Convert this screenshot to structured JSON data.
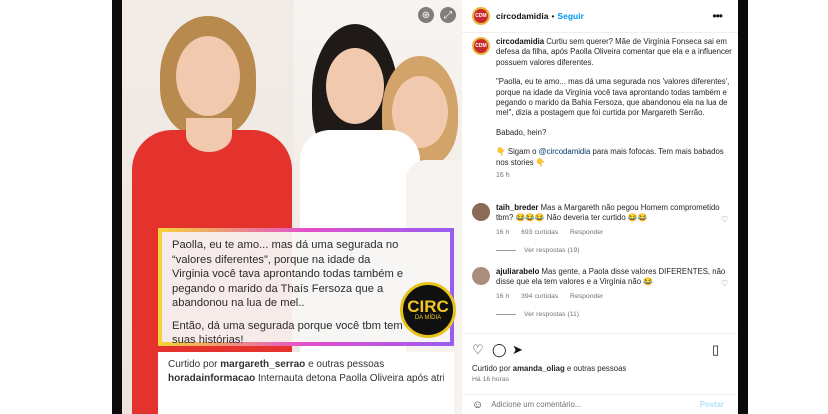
{
  "header": {
    "username": "circodamidia",
    "separator": "•",
    "follow_label": "Seguir",
    "more_icon": "more-horizontal-icon"
  },
  "overlay": {
    "lines": [
      "Paolla, eu te amo... mas dá uma segurada no",
      "“valores diferentes”, porque na idade da",
      "Virginia você tava aprontando todas também e",
      "pegando o marido da Thaís Fersoza que a",
      "abandonou na lua de mel..",
      "",
      "Então, dá uma segurada porque você tbm tem",
      "suas histórias!"
    ],
    "liked_prefix": "Curtido por",
    "liked_user": "margareth_serrao",
    "liked_suffix": "e outras pessoas",
    "source_user": "horadainformacao",
    "source_text": "Internauta detona Paolla Oliveira após atriz dizer que ela tem valores diferentes de Virginia... mais",
    "logo_top": "CIRC",
    "logo_bottom": "DA MÍDIA"
  },
  "caption": {
    "username": "circodamidia",
    "text": "Curtiu sem querer? Mãe de Virgínia Fonseca sai em defesa da filha, após Paolla Oliveira comentar que ela e a influencer possuem valores diferentes.",
    "quote": "\"Paolla, eu te amo... mas dá uma segurada nos 'valores diferentes', porque na idade da Virgínia você tava aprontando todas também e pegando o marido da Bahia Fersoza, que abandonou ela na lua de mel\", dizia a postagem que foi curtida por Margareth Serrão.",
    "babado": "Babado, hein?",
    "cta_prefix": "👇 Sigam o",
    "cta_mention": "@circodamidia",
    "cta_suffix": "para mais fofocas. Tem mais babados nos stories 👇",
    "time": "16 h"
  },
  "comments": [
    {
      "username": "taih_breder",
      "text": "Mas a Margareth não pegou Homem comprometido tbm? 😂😂😂 Não deveria ter curtido 😂😂",
      "time": "16 h",
      "likes": "693 curtidas",
      "reply": "Responder",
      "view_replies": "Ver respostas (19)",
      "avatar_color": "#8b6a58"
    },
    {
      "username": "ajuliarabelo",
      "text": "Mas gente, a Paola disse valores DIFERENTES, não disse que ela tem valores e a Virgínia não 😂",
      "time": "16 h",
      "likes": "394 curtidas",
      "reply": "Responder",
      "view_replies": "Ver respostas (11)",
      "avatar_color": "#a98e7c"
    }
  ],
  "actions": {
    "like_icon": "heart-icon",
    "comment_icon": "comment-icon",
    "share_icon": "share-icon",
    "save_icon": "bookmark-icon"
  },
  "likes_line": {
    "prefix": "Curtido por",
    "user": "amanda_oliag",
    "suffix": "e outras pessoas"
  },
  "post_time": "Há 16 horas",
  "comment_box": {
    "placeholder": "Adicione um comentário...",
    "post_label": "Postar"
  },
  "colors": {
    "accent": "#0095f6",
    "brand_red": "#c9282d",
    "overlay_border_start": "#f6d23a",
    "overlay_border_end": "#9a5cf0"
  }
}
